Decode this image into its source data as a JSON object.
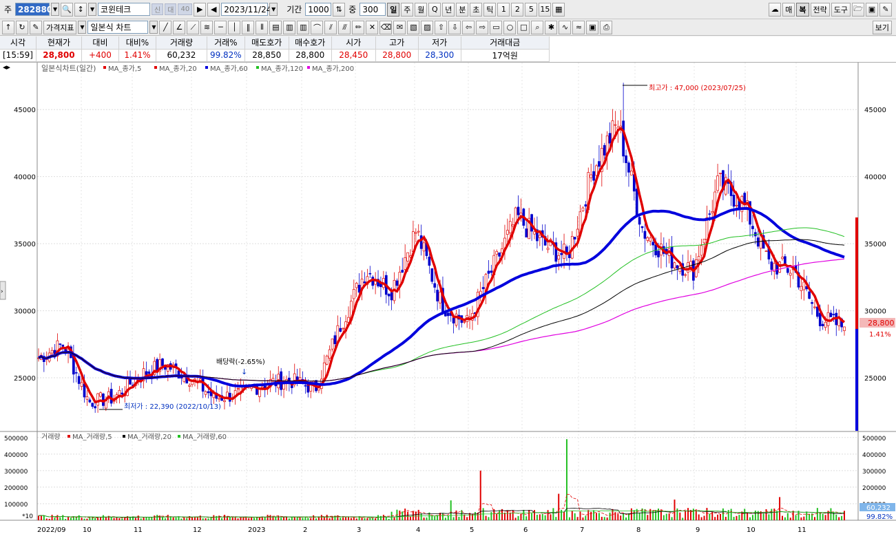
{
  "toolbar": {
    "label_stock": "주",
    "code": "282880",
    "name": "코윈테크",
    "tag1": "신",
    "tag2": "대",
    "tag3": "40",
    "date": "2023/11/24",
    "label_period": "기간",
    "period": "1000",
    "label_overlap": "중",
    "overlap": "300",
    "timeframes": [
      "일",
      "주",
      "월",
      "Q",
      "년",
      "분",
      "초",
      "틱",
      "1",
      "2",
      "5",
      "15"
    ],
    "active_timeframe": "일",
    "right_buttons": [
      "매",
      "복",
      "전략",
      "도구"
    ]
  },
  "toolbar2": {
    "indicator_label": "가격지표",
    "chart_type": "일본식 차트",
    "view_label": "보기"
  },
  "quote": {
    "headers": [
      "시각",
      "현재가",
      "대비",
      "대비%",
      "거래량",
      "거래%",
      "매도호가",
      "매수호가",
      "시가",
      "고가",
      "저가",
      "거래대금"
    ],
    "values": [
      "[15:59]",
      "28,800",
      "+400",
      "1.41%",
      "60,232",
      "99.82%",
      "28,850",
      "28,800",
      "28,450",
      "28,800",
      "28,300",
      "17억원"
    ]
  },
  "chart": {
    "legend_title": "일본식차트(일간)",
    "ma_legend": [
      {
        "label": "MA_종가,5",
        "color": "#e00000"
      },
      {
        "label": "MA_종가,20",
        "color": "#e00000"
      },
      {
        "label": "MA_종가,60",
        "color": "#0000dd"
      },
      {
        "label": "MA_종가,120",
        "color": "#22c022"
      },
      {
        "label": "MA_종가,200",
        "color": "#e000e0"
      }
    ],
    "high_note": "최고가 : 47,000 (2023/07/25)",
    "low_note": "최저가 : 22,390 (2022/10/13)",
    "dividend_note": "배당락(-2.65%)",
    "price_label": "28,800",
    "pct_label": "1.41%",
    "vol_legend_title": "거래량",
    "vol_ma_legend": [
      {
        "label": "MA_거래량,5",
        "color": "#e00000"
      },
      {
        "label": "MA_거래량,20",
        "color": "#000000"
      },
      {
        "label": "MA_거래량,60",
        "color": "#22c022"
      }
    ],
    "vol_label": "60,232",
    "vol_pct_label": "99.82%",
    "vol_multiplier": "*10",
    "y_ticks": [
      "45000",
      "40000",
      "35000",
      "30000",
      "25000"
    ],
    "vol_ticks": [
      "500000",
      "400000",
      "300000",
      "200000",
      "100000"
    ],
    "x_labels": [
      "2022/09",
      "10",
      "11",
      "12",
      "2023",
      "2",
      "3",
      "4",
      "5",
      "6",
      "7",
      "8",
      "9",
      "10",
      "11"
    ]
  },
  "chart_data": {
    "type": "candlestick",
    "title": "일본식차트(일간)",
    "y_range": [
      21000,
      48500
    ],
    "volume_range": [
      0,
      520000
    ],
    "key_points": [
      {
        "date": "2022/09",
        "close": 26500
      },
      {
        "date": "2022/10/13",
        "low": 22390
      },
      {
        "date": "2022/10",
        "close": 23500
      },
      {
        "date": "2022/11",
        "close": 25000
      },
      {
        "date": "2022/12",
        "close": 26000
      },
      {
        "date": "2023/01",
        "close": 23800
      },
      {
        "date": "2023/02",
        "close": 24500
      },
      {
        "date": "2023/03",
        "close": 28000
      },
      {
        "date": "2023/04",
        "close": 33000
      },
      {
        "date": "2023/05",
        "close": 29000
      },
      {
        "date": "2023/06",
        "close": 36000
      },
      {
        "date": "2023/07/25",
        "high": 47000
      },
      {
        "date": "2023/08",
        "close": 34000
      },
      {
        "date": "2023/09",
        "close": 39500
      },
      {
        "date": "2023/10",
        "close": 33500
      },
      {
        "date": "2023/11/24",
        "close": 28800
      }
    ]
  }
}
